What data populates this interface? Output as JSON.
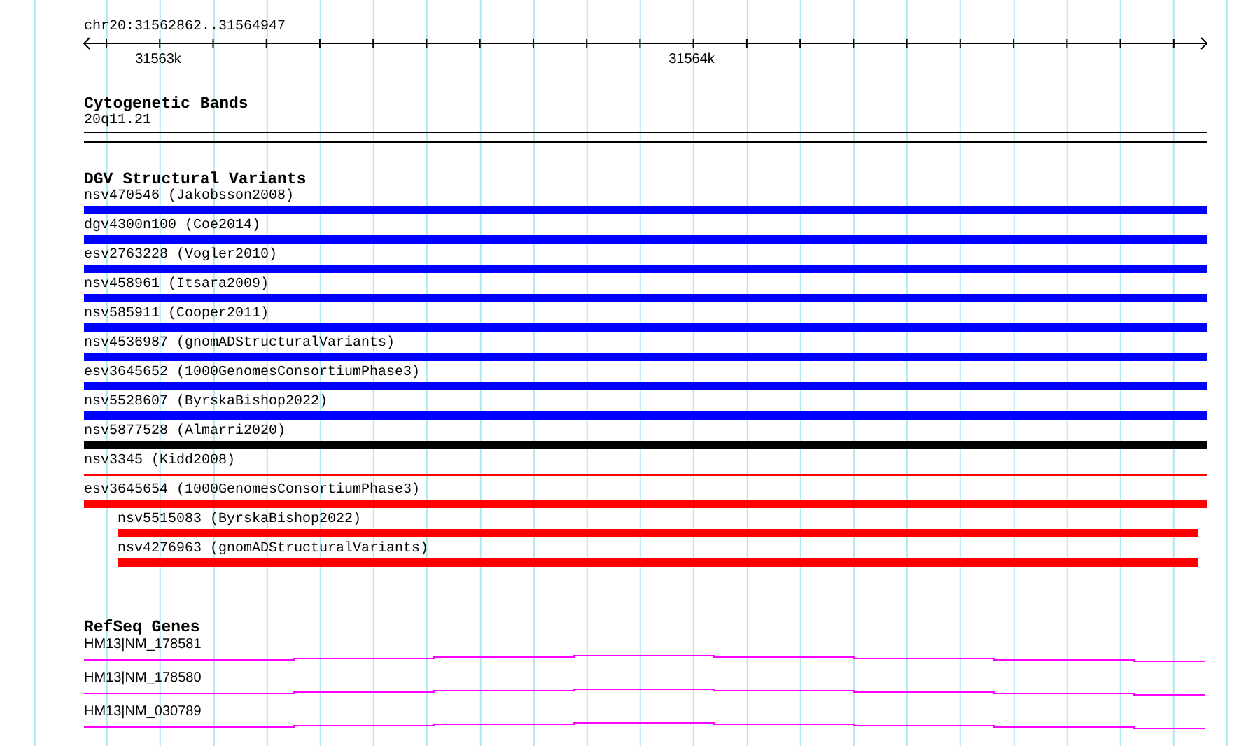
{
  "region": {
    "label": "chr20:31562862..31564947",
    "ticks": [
      "31563k",
      "31564k"
    ]
  },
  "cytogenetic_bands": {
    "title": "Cytogenetic Bands",
    "band": "20q11.21"
  },
  "dgv_structural_variants": {
    "title": "DGV Structural Variants",
    "items": [
      {
        "label": "nsv470546 (Jakobsson2008)",
        "color": "#0000ff",
        "kind": "bar"
      },
      {
        "label": "dgv4300n100 (Coe2014)",
        "color": "#0000ff",
        "kind": "bar"
      },
      {
        "label": "esv2763228 (Vogler2010)",
        "color": "#0000ff",
        "kind": "bar"
      },
      {
        "label": "nsv458961 (Itsara2009)",
        "color": "#0000ff",
        "kind": "bar"
      },
      {
        "label": "nsv585911 (Cooper2011)",
        "color": "#0000ff",
        "kind": "bar"
      },
      {
        "label": "nsv4536987 (gnomADStructuralVariants)",
        "color": "#0000ff",
        "kind": "bar"
      },
      {
        "label": "esv3645652 (1000GenomesConsortiumPhase3)",
        "color": "#0000ff",
        "kind": "bar"
      },
      {
        "label": "nsv5528607 (ByrskaBishop2022)",
        "color": "#0000ff",
        "kind": "bar"
      },
      {
        "label": "nsv5877528 (Almarri2020)",
        "color": "#000000",
        "kind": "bar"
      },
      {
        "label": "nsv3345 (Kidd2008)",
        "color": "#ff0000",
        "kind": "line"
      },
      {
        "label": "esv3645654 (1000GenomesConsortiumPhase3)",
        "color": "#ff0000",
        "kind": "bar",
        "children": [
          {
            "label": "nsv5515083 (ByrskaBishop2022)",
            "color": "#ff0000",
            "kind": "bar"
          },
          {
            "label": "nsv4276963 (gnomADStructuralVariants)",
            "color": "#ff0000",
            "kind": "bar"
          }
        ]
      }
    ]
  },
  "refseq_genes": {
    "title": "RefSeq Genes",
    "items": [
      {
        "label": "HM13|NM_178581"
      },
      {
        "label": "HM13|NM_178580"
      },
      {
        "label": "HM13|NM_030789"
      }
    ]
  }
}
